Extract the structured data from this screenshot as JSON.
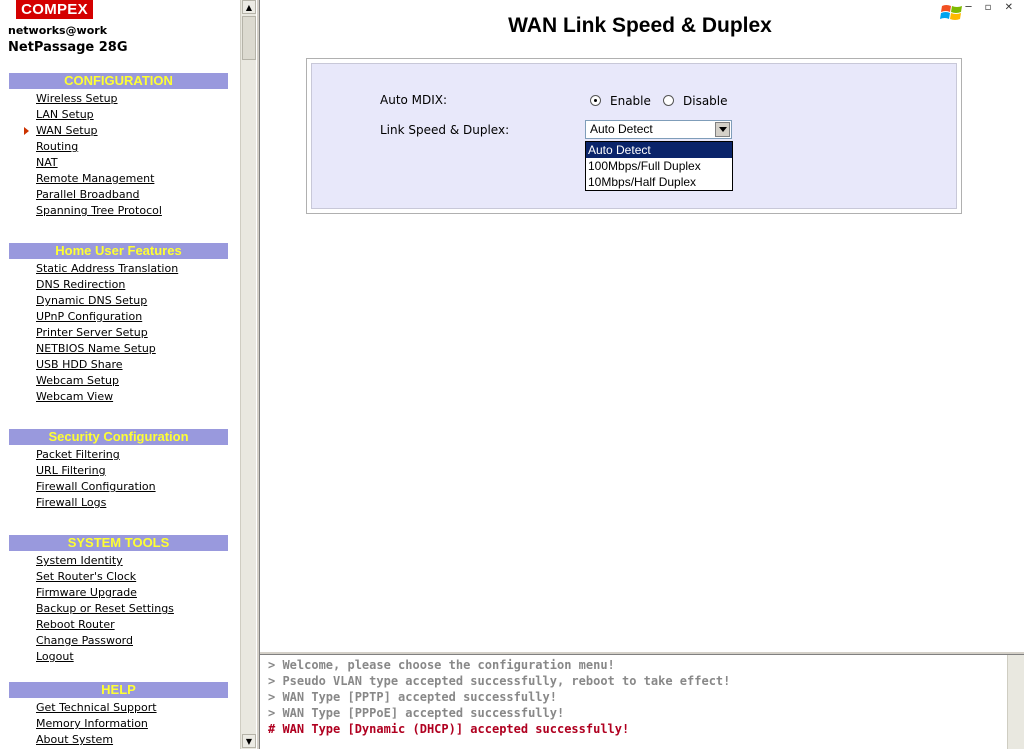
{
  "brand": {
    "logo": "COMPEX",
    "tagline": "networks@work",
    "product": "NetPassage 28G"
  },
  "sidebar": {
    "sections": [
      {
        "title": "CONFIGURATION",
        "items": [
          "Wireless Setup",
          "LAN Setup",
          "WAN Setup",
          "Routing",
          "NAT",
          "Remote Management",
          "Parallel Broadband",
          "Spanning Tree Protocol"
        ],
        "active_index": 2
      },
      {
        "title": "Home User Features",
        "items": [
          "Static Address Translation",
          "DNS Redirection",
          "Dynamic DNS Setup",
          "UPnP Configuration",
          "Printer Server Setup",
          "NETBIOS Name Setup",
          "USB HDD Share",
          "Webcam Setup",
          "Webcam View"
        ]
      },
      {
        "title": "Security Configuration",
        "items": [
          "Packet Filtering",
          "URL Filtering",
          "Firewall Configuration",
          "Firewall Logs"
        ]
      },
      {
        "title": "SYSTEM TOOLS",
        "items": [
          "System Identity",
          "Set Router's Clock",
          "Firmware Upgrade",
          "Backup or Reset Settings",
          "Reboot Router",
          "Change Password",
          "Logout"
        ]
      },
      {
        "title": "HELP",
        "items": [
          "Get Technical Support",
          "Memory Information",
          "About System"
        ]
      }
    ]
  },
  "main": {
    "title": "WAN Link Speed & Duplex",
    "auto_mdix": {
      "label": "Auto MDIX:",
      "options": [
        "Enable",
        "Disable"
      ],
      "selected": "Enable"
    },
    "link_speed": {
      "label": "Link Speed & Duplex:",
      "value": "Auto Detect",
      "options": [
        "Auto Detect",
        "100Mbps/Full Duplex",
        "10Mbps/Half Duplex"
      ],
      "highlighted": "Auto Detect"
    }
  },
  "status_log": [
    "> Welcome, please choose the configuration menu!",
    "> Pseudo VLAN type accepted successfully, reboot to take effect!",
    "> WAN Type [PPTP] accepted successfully!",
    "> WAN Type [PPPoE] accepted successfully!",
    "# WAN Type [Dynamic (DHCP)] accepted successfully!"
  ],
  "colors": {
    "section_header_bg": "#9999dd",
    "section_header_text": "#ffff33",
    "logo_bg": "#d40000",
    "panel_bg": "#e8e8fa",
    "current_log": "#b00020"
  }
}
